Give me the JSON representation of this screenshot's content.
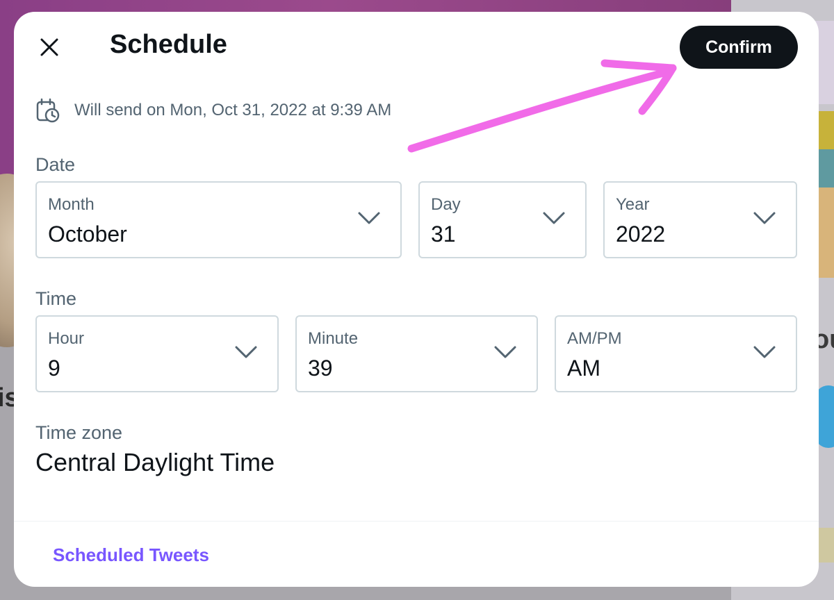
{
  "colors": {
    "accent_link": "#7856ff",
    "button_bg": "#0f1419",
    "annotation_arrow": "#ef5be6"
  },
  "modal": {
    "title": "Schedule",
    "close_icon": "close-icon",
    "confirm_label": "Confirm",
    "send_summary": "Will send on Mon, Oct 31, 2022 at 9:39 AM",
    "send_icon": "calendar-clock-icon"
  },
  "date": {
    "section_label": "Date",
    "month": {
      "label": "Month",
      "value": "October"
    },
    "day": {
      "label": "Day",
      "value": "31"
    },
    "year": {
      "label": "Year",
      "value": "2022"
    }
  },
  "time": {
    "section_label": "Time",
    "hour": {
      "label": "Hour",
      "value": "9"
    },
    "minute": {
      "label": "Minute",
      "value": "39"
    },
    "ampm": {
      "label": "AM/PM",
      "value": "AM"
    }
  },
  "timezone": {
    "label": "Time zone",
    "value": "Central Daylight Time"
  },
  "footer": {
    "scheduled_link": "Scheduled Tweets"
  },
  "background": {
    "right_glyph_1": "ou",
    "left_glyph_1": "is"
  }
}
